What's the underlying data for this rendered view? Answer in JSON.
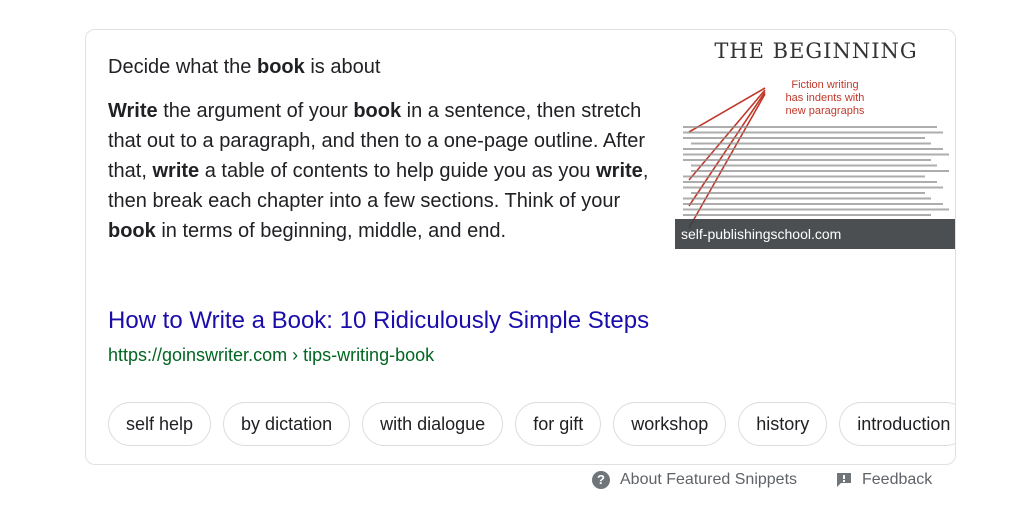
{
  "snippet": {
    "heading_pre": "Decide what the ",
    "heading_bold": "book",
    "heading_post": " is about",
    "body": [
      {
        "b": "Write"
      },
      {
        "t": " the argument of your "
      },
      {
        "b": "book"
      },
      {
        "t": " in a sentence, then stretch that out to a paragraph, and then to a one-page outline. After that, "
      },
      {
        "b": "write"
      },
      {
        "t": " a table of contents to help guide you as you "
      },
      {
        "b": "write"
      },
      {
        "t": ", then break each chapter into a few sections. Think of your "
      },
      {
        "b": "book"
      },
      {
        "t": " in terms of beginning, middle, and end."
      }
    ]
  },
  "thumbnail": {
    "heading": "THE BEGINNING",
    "annotation_lines": [
      "Fiction writing",
      "has indents with",
      "new paragraphs"
    ],
    "source": "self-publishingschool.com"
  },
  "result": {
    "title": "How to Write a Book: 10 Ridiculously Simple Steps",
    "url": "https://goinswriter.com › tips-writing-book"
  },
  "chips": [
    "self help",
    "by dictation",
    "with dialogue",
    "for gift",
    "workshop",
    "history",
    "introduction"
  ],
  "footer": {
    "about": "About Featured Snippets",
    "feedback": "Feedback"
  },
  "colors": {
    "link": "#1a0dab",
    "url": "#006621",
    "annotation": "#c0392b"
  }
}
